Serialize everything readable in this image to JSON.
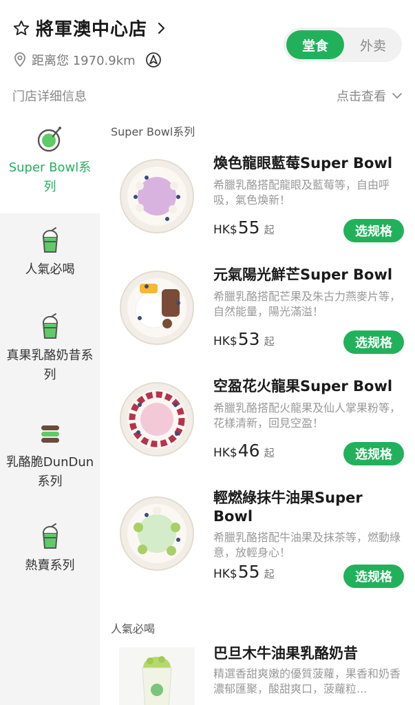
{
  "store": {
    "name": "將軍澳中心店",
    "distance": "距离您 1970.9km"
  },
  "mode": {
    "dine_in": "堂食",
    "takeaway": "外卖"
  },
  "info": {
    "label": "门店详细信息",
    "link": "点击查看"
  },
  "colors": {
    "accent": "#22b15b"
  },
  "sidebar": {
    "items": [
      {
        "label": "Super Bowl系列",
        "icon": "bowl-icon",
        "active": true
      },
      {
        "label": "人氣必喝",
        "icon": "cup-icon",
        "active": false
      },
      {
        "label": "真果乳酪奶昔系列",
        "icon": "cup-icon",
        "active": false
      },
      {
        "label": "乳酪脆DunDun系列",
        "icon": "stacked-snack-icon",
        "active": false
      },
      {
        "label": "熱賣系列",
        "icon": "cup-icon",
        "active": false
      }
    ]
  },
  "sections": {
    "super_bowl": "Super Bowl系列",
    "popular": "人氣必喝"
  },
  "products": [
    {
      "name": "煥色龍眼藍莓Super Bowl",
      "desc": "希臘乳酪搭配龍眼及藍莓等，自由呼吸，氣色煥新！",
      "currency": "HK$",
      "price": "55",
      "suffix": "起",
      "button": "选规格"
    },
    {
      "name": "元氣陽光鮮芒Super Bowl",
      "desc": "希臘乳酪搭配芒果及朱古力燕麥片等，自然能量，陽光滿溢！",
      "currency": "HK$",
      "price": "53",
      "suffix": "起",
      "button": "选规格"
    },
    {
      "name": "空盈花火龍果Super Bowl",
      "desc": "希臘乳酪搭配火龍果及仙人掌果粉等，花樣清新，回見空盈！",
      "currency": "HK$",
      "price": "46",
      "suffix": "起",
      "button": "选规格"
    },
    {
      "name": "輕燃綠抹牛油果Super Bowl",
      "desc": "希臘乳酪搭配牛油果及抹茶等，燃動綠意，放輕身心！",
      "currency": "HK$",
      "price": "55",
      "suffix": "起",
      "button": "选规格"
    },
    {
      "name": "巴旦木牛油果乳酪奶昔",
      "desc": "精選香甜爽嫩的優質菠蘿，果香和奶香濃郁匯聚，酸甜爽口，菠蘿粒..."
    }
  ]
}
